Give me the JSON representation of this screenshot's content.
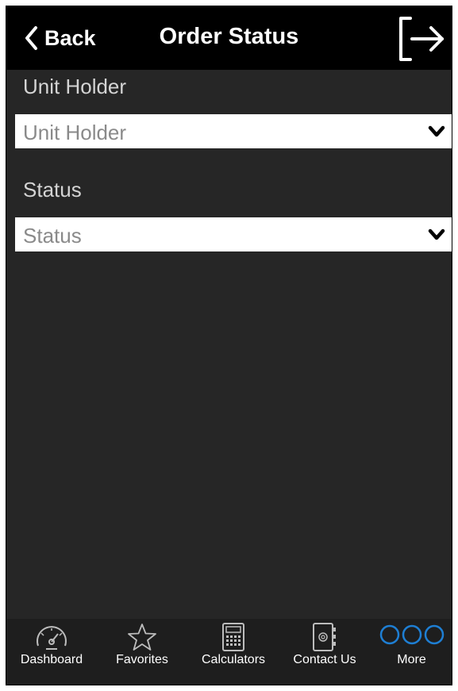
{
  "header": {
    "back_label": "Back",
    "title": "Order Status"
  },
  "form": {
    "unit_holder": {
      "label": "Unit Holder",
      "value": "Unit Holder"
    },
    "status": {
      "label": "Status",
      "value": "Status"
    }
  },
  "tabbar": {
    "items": [
      {
        "label": "Dashboard",
        "icon": "speedometer-icon"
      },
      {
        "label": "Favorites",
        "icon": "star-icon"
      },
      {
        "label": "Calculators",
        "icon": "calculator-icon"
      },
      {
        "label": "Contact Us",
        "icon": "address-book-icon"
      },
      {
        "label": "More",
        "icon": "more-icon"
      }
    ]
  },
  "colors": {
    "background": "#262626",
    "header": "#000000",
    "accent": "#1e7fd4",
    "field_text": "#8a8a8a",
    "label_text": "#d4d4d4"
  }
}
